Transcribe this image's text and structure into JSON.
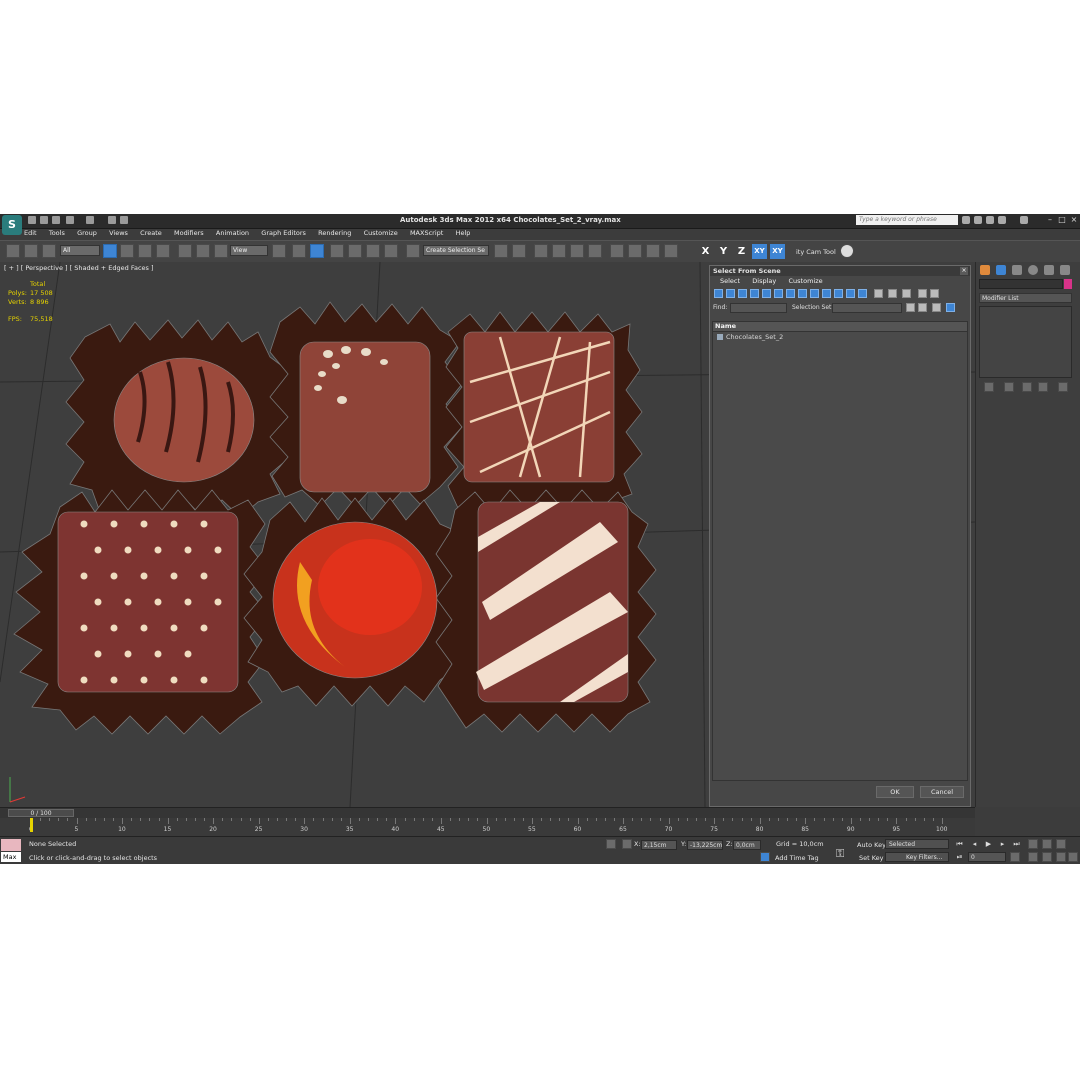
{
  "window": {
    "title": "Autodesk 3ds Max  2012 x64      Chocolates_Set_2_vray.max",
    "search_placeholder": "Type a keyword or phrase",
    "logo_icon": "max-logo-icon"
  },
  "menu": [
    "Edit",
    "Tools",
    "Group",
    "Views",
    "Create",
    "Modifiers",
    "Animation",
    "Graph Editors",
    "Rendering",
    "Customize",
    "MAXScript",
    "Help"
  ],
  "toolbar": {
    "selection_filter": "All",
    "ref_coord": "View",
    "named_selection": "Create Selection Se",
    "axes": [
      "X",
      "Y",
      "Z",
      "XY",
      "XY"
    ],
    "cam_tool": "ity Cam Tool"
  },
  "viewport": {
    "label": "[ + ] [ Perspective ] [ Shaded + Edged Faces ]",
    "stats_header": "Total",
    "stats": [
      {
        "label": "Polys:",
        "value": "17 508"
      },
      {
        "label": "Verts:",
        "value": "8 896"
      },
      {
        "label": "FPS:",
        "value": "75,518"
      }
    ]
  },
  "dialog": {
    "title": "Select From Scene",
    "tabs": [
      "Select",
      "Display",
      "Customize"
    ],
    "find_label": "Find:",
    "selection_set_label": "Selection Set:",
    "column_header": "Name",
    "items": [
      "Chocolates_Set_2"
    ],
    "ok": "OK",
    "cancel": "Cancel"
  },
  "command_panel": {
    "modifier_list": "Modifier List",
    "object_color": "#d8338a"
  },
  "timeline": {
    "frame_display": "0 / 100",
    "ticks": [
      0,
      5,
      10,
      15,
      20,
      25,
      30,
      35,
      40,
      45,
      50,
      55,
      60,
      65,
      70,
      75,
      80,
      85,
      90,
      95,
      100
    ]
  },
  "status": {
    "maxscript_label": "Max",
    "selection": "None Selected",
    "prompt": "Click or click-and-drag to select objects",
    "x_label": "X:",
    "x_value": "2,15cm",
    "y_label": "Y:",
    "y_value": "-13,225cm",
    "z_label": "Z:",
    "z_value": "0,0cm",
    "grid": "Grid = 10,0cm",
    "add_time_tag": "Add Time Tag",
    "auto_key": "Auto Key",
    "set_key": "Set Key",
    "key_mode": "Selected",
    "key_filters": "Key Filters...",
    "current_frame": "0"
  }
}
